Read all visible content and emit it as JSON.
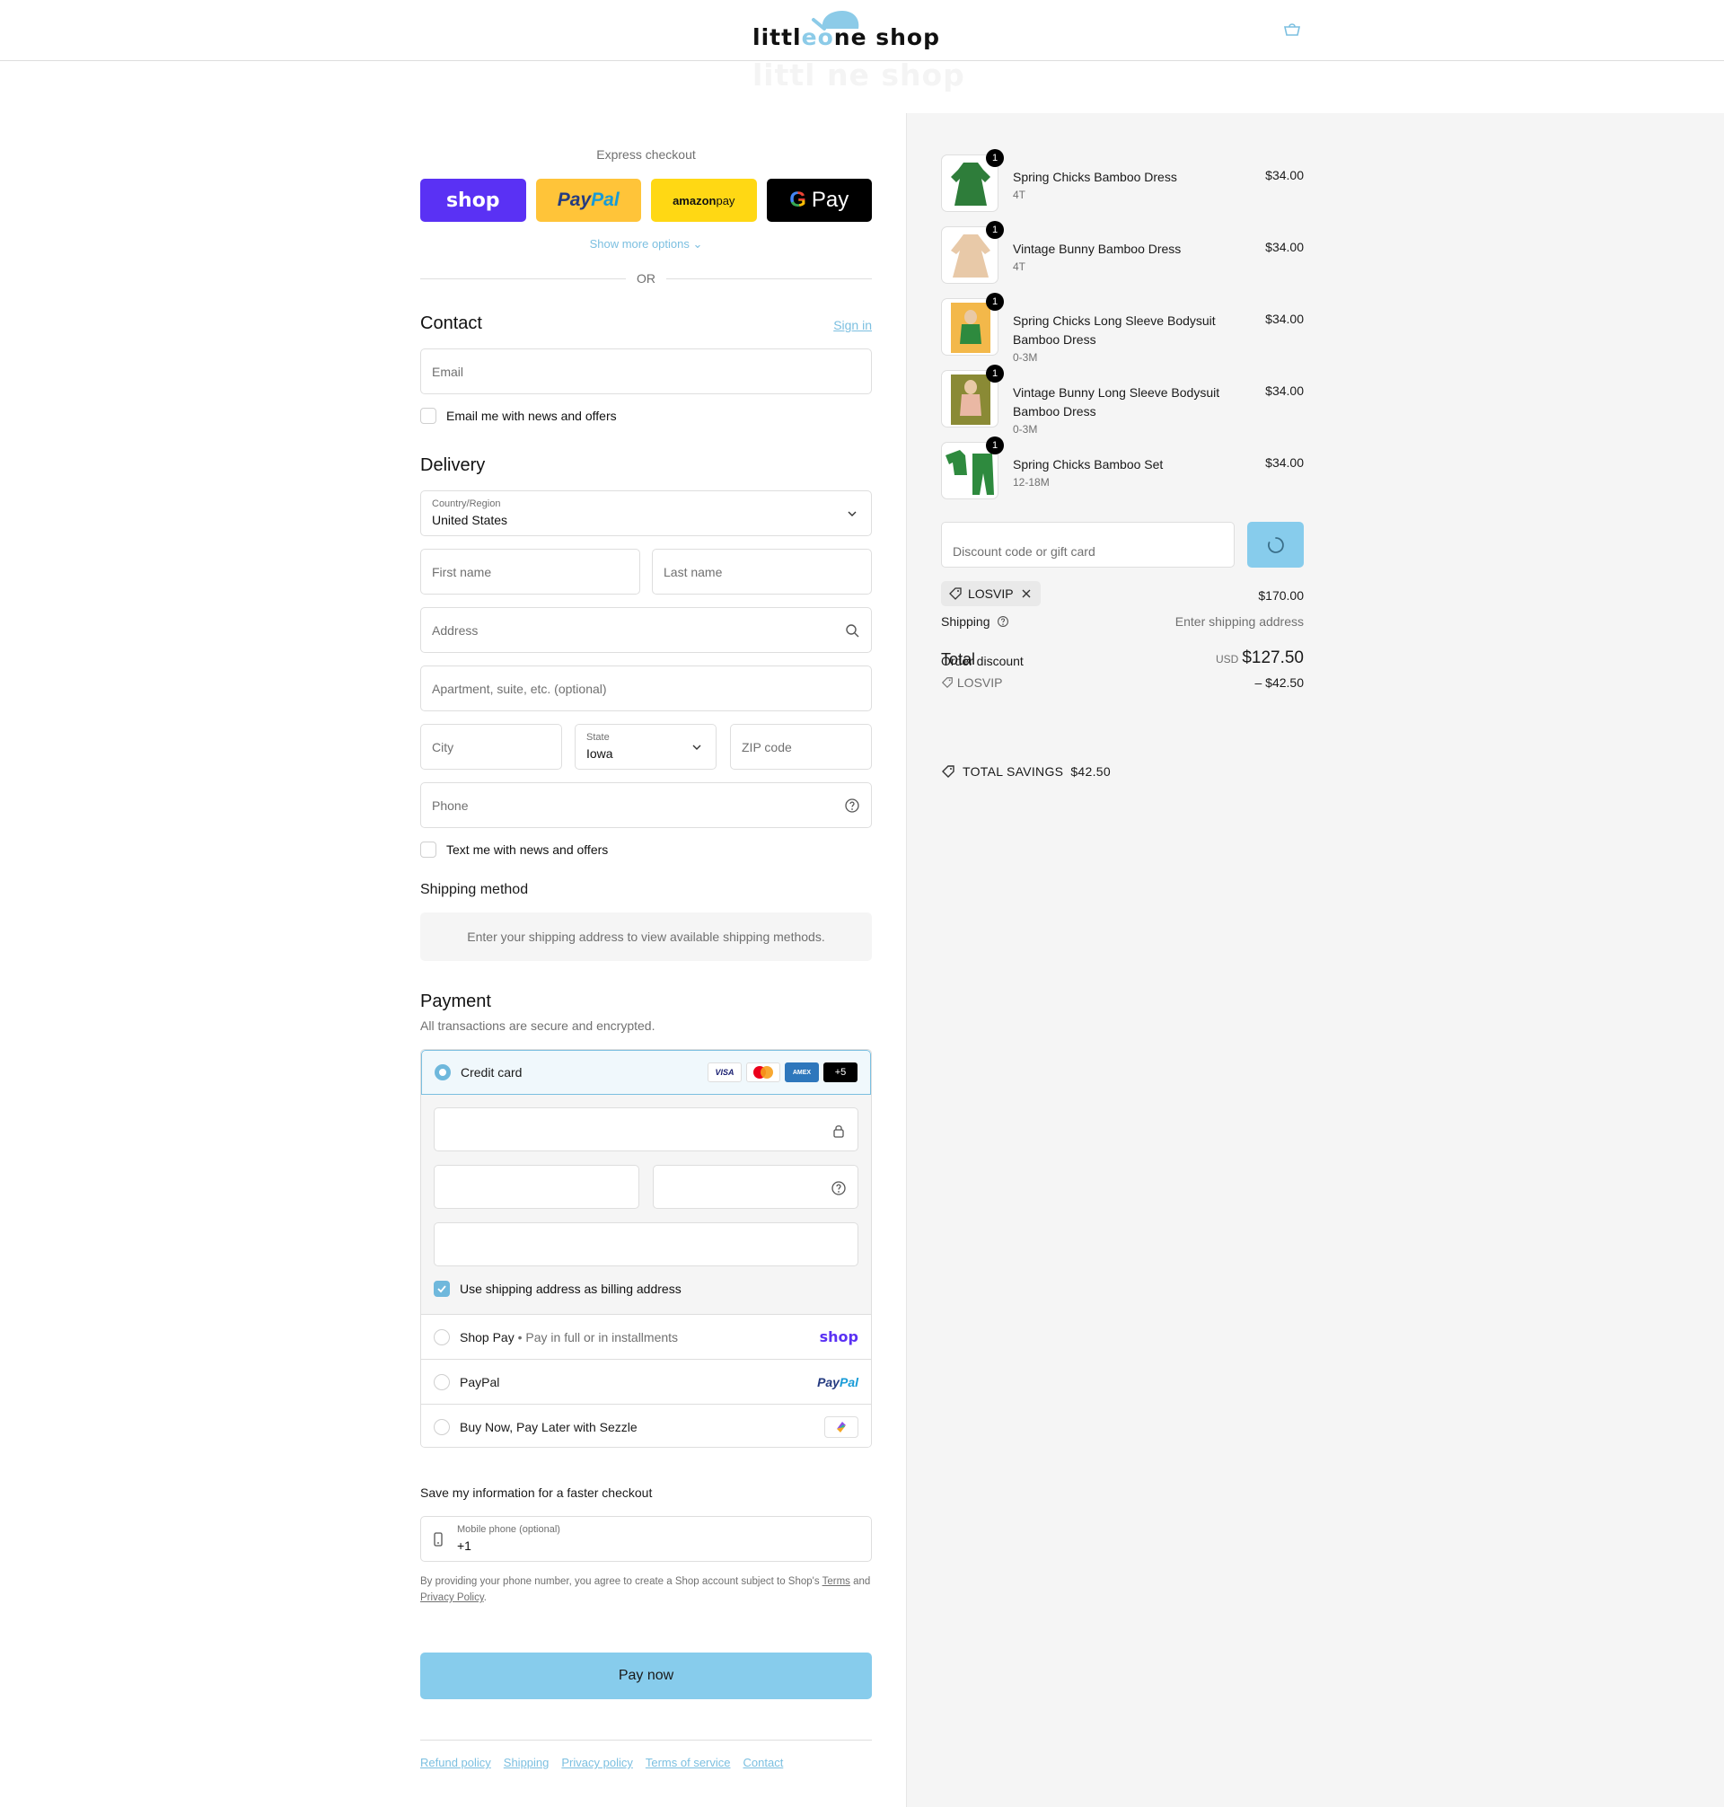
{
  "header": {
    "logo_text_a": "littl",
    "logo_text_b": "e",
    "logo_text_c": "o",
    "logo_text_d": "ne shop",
    "cart_icon": "cart-icon"
  },
  "express": {
    "title": "Express checkout",
    "shop_label": "shop",
    "paypal_a": "Pay",
    "paypal_b": "Pal",
    "amazon_a": "amazon",
    "amazon_b": " pay",
    "gpay_g": "G",
    "gpay_label": "Pay",
    "more_options": "Show more options ⌄",
    "or": "OR"
  },
  "contact": {
    "title": "Contact",
    "sign_in": "Sign in",
    "email_placeholder": "Email",
    "news_label": "Email me with news and offers"
  },
  "delivery": {
    "title": "Delivery",
    "country_label": "Country/Region",
    "country_value": "United States",
    "first_name": "First name",
    "last_name": "Last name",
    "address": "Address",
    "apartment": "Apartment, suite, etc. (optional)",
    "city": "City",
    "state_label": "State",
    "state_value": "Iowa",
    "zip": "ZIP code",
    "phone": "Phone",
    "text_label": "Text me with news and offers"
  },
  "shipping_method": {
    "title": "Shipping method",
    "info": "Enter your shipping address to view available shipping methods."
  },
  "payment": {
    "title": "Payment",
    "subtitle": "All transactions are secure and encrypted.",
    "credit_card_label": "Credit card",
    "cards": [
      "VISA",
      "AMEX",
      "+5"
    ],
    "billing_label": "Use shipping address as billing address",
    "shop_pay_label": "Shop Pay",
    "shop_pay_sub": "Pay in full or in installments",
    "shop_pay_logo": "shop",
    "paypal_label": "PayPal",
    "paypal_logo_a": "Pay",
    "paypal_logo_b": "Pal",
    "sezzle_label": "Buy Now, Pay Later with Sezzle"
  },
  "save_info": {
    "title": "Save my information for a faster checkout",
    "mobile_label": "Mobile phone (optional)",
    "mobile_value": "+1",
    "legal_a": "By providing your phone number, you agree to create a Shop account subject to Shop's ",
    "legal_terms": "Terms",
    "legal_b": " and ",
    "legal_privacy": "Privacy Policy",
    "legal_c": "."
  },
  "pay_now": "Pay now",
  "footer": {
    "links": [
      "Refund policy",
      "Shipping",
      "Privacy policy",
      "Terms of service",
      "Contact"
    ]
  },
  "cart": {
    "items": [
      {
        "name": "Spring Chicks Bamboo Dress",
        "variant": "4T",
        "price": "$34.00",
        "qty": "1",
        "color": "#2e7d3a"
      },
      {
        "name": "Vintage Bunny Bamboo Dress",
        "variant": "4T",
        "price": "$34.00",
        "qty": "1",
        "color": "#e8c9a8"
      },
      {
        "name": "Spring Chicks Long Sleeve Bodysuit Bamboo Dress",
        "variant": "0-3M",
        "price": "$34.00",
        "qty": "1",
        "color": "#f3b84a"
      },
      {
        "name": "Vintage Bunny Long Sleeve Bodysuit Bamboo Dress",
        "variant": "0-3M",
        "price": "$34.00",
        "qty": "1",
        "color": "#8a8a35"
      },
      {
        "name": "Spring Chicks Bamboo Set",
        "variant": "12-18M",
        "price": "$34.00",
        "qty": "1",
        "color": "#2e8a3e"
      }
    ],
    "discount_placeholder": "Discount code or gift card",
    "code": "LOSVIP",
    "subtotal": "$170.00",
    "shipping_label": "Shipping",
    "shipping_value": "Enter shipping address",
    "total_label": "Total",
    "currency": "USD",
    "total": "$127.50",
    "order_discount_label": "Order discount",
    "order_discount_code": "LOSVIP",
    "order_discount_value": "– $42.50",
    "savings_label": "TOTAL SAVINGS",
    "savings_value": "$42.50"
  },
  "colors": {
    "accent": "#87ccec",
    "link": "#7bbfe0",
    "shop_pay": "#5a31f4",
    "paypal": "#ffc439",
    "amazon": "#ffd814"
  }
}
